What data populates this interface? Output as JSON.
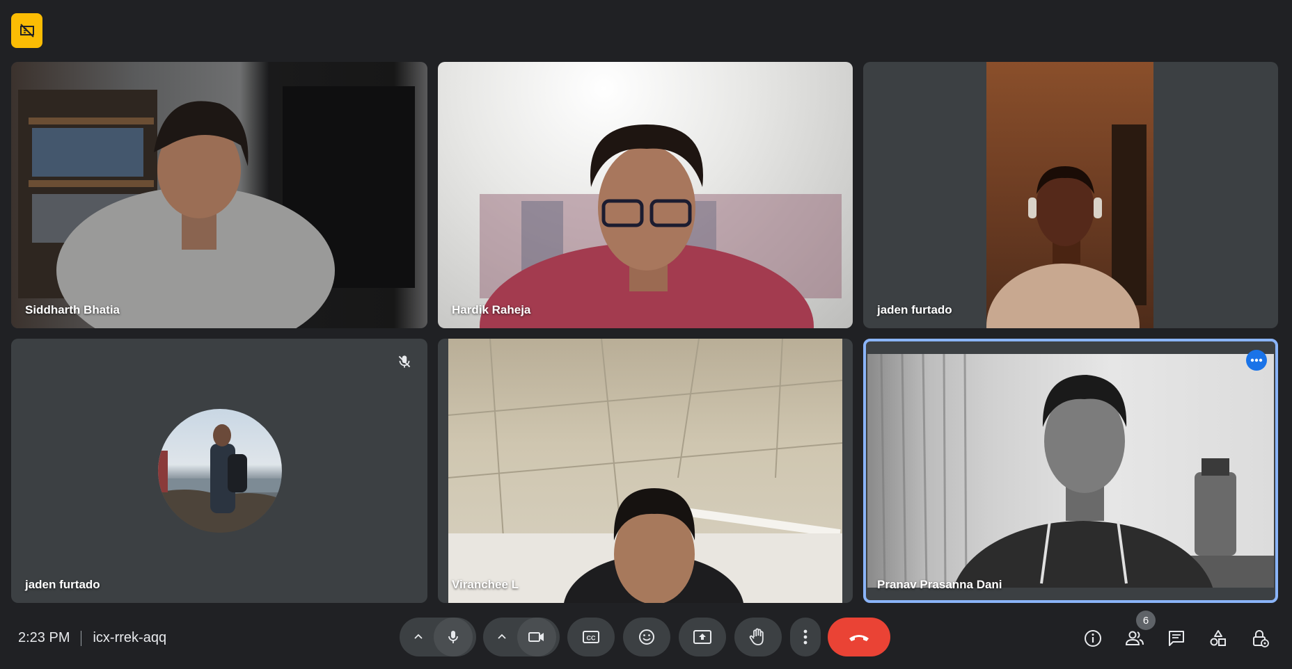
{
  "participants": [
    {
      "name": "Siddharth Bhatia"
    },
    {
      "name": "Hardik Raheja"
    },
    {
      "name": "jaden furtado"
    },
    {
      "name": "jaden furtado"
    },
    {
      "name": "Viranchee L"
    },
    {
      "name": "Pranav Prasanna Dani"
    }
  ],
  "toolbar": {
    "time": "2:23 PM",
    "meeting_code": "icx-rrek-aqq",
    "people_count": "6"
  },
  "colors": {
    "background": "#202124",
    "tile": "#3c4043",
    "active_outline": "#8ab4f8",
    "end_call": "#ea4335",
    "badge": "#fbbc04"
  },
  "icons": {
    "top_badge": "no-visual-icon",
    "mic": "mic-icon",
    "camera": "camera-icon",
    "captions": "captions-icon",
    "emoji": "emoji-icon",
    "present": "present-icon",
    "hand": "raise-hand-icon",
    "more": "more-vert-icon",
    "end": "end-call-icon",
    "info": "info-icon",
    "people": "people-icon",
    "chat": "chat-icon",
    "activities": "activities-icon",
    "host": "host-controls-icon"
  }
}
